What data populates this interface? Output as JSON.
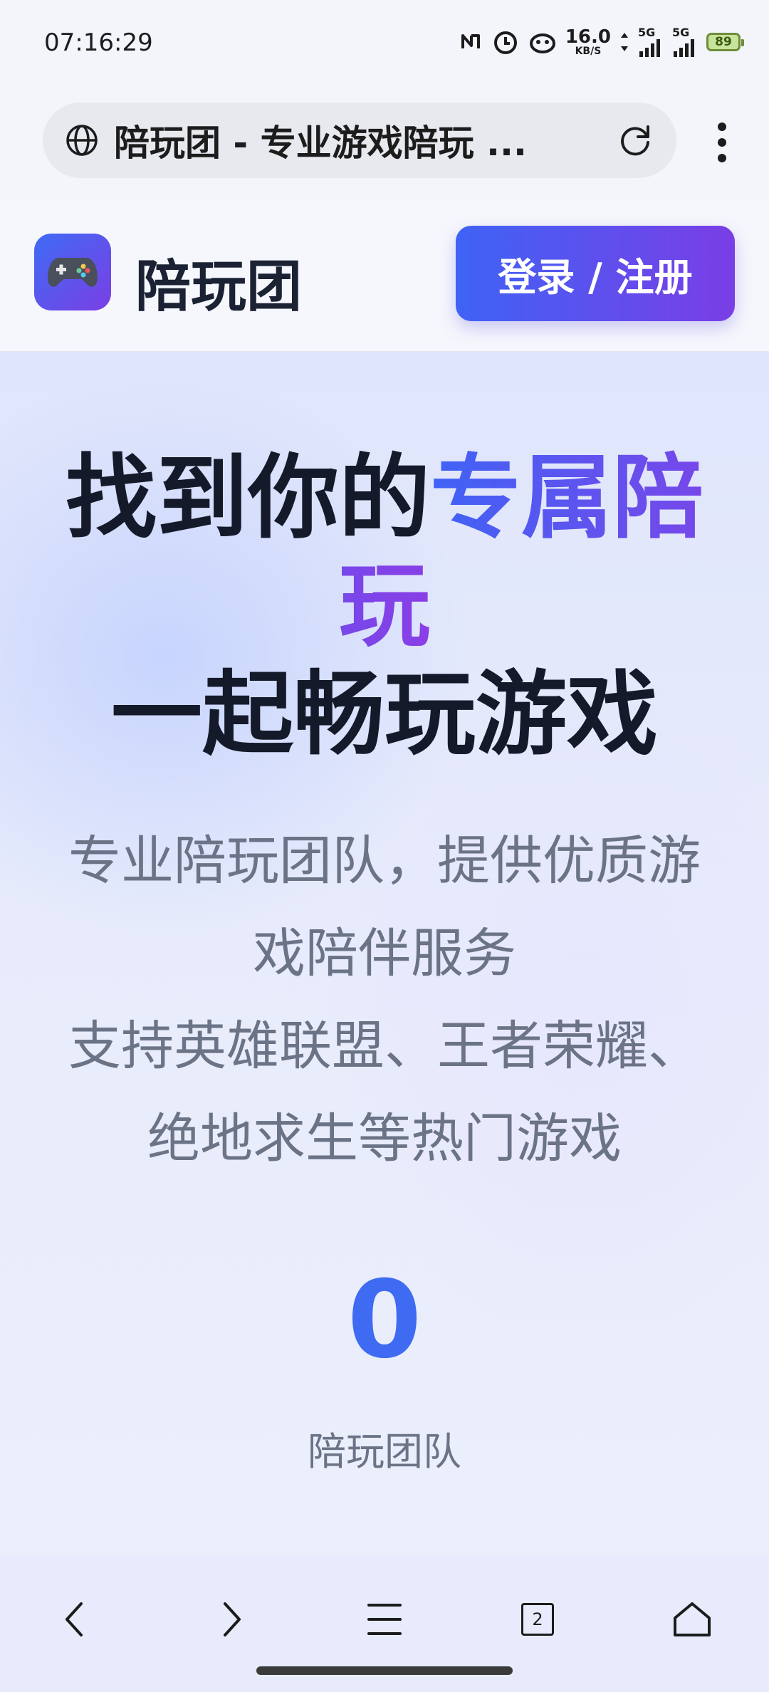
{
  "status_bar": {
    "time": "07:16:29",
    "net_speed_value": "16.0",
    "net_speed_unit": "KB/S",
    "signal_label_1": "5G",
    "signal_label_2": "5G",
    "battery": "89",
    "icons": [
      "nfc-icon",
      "alarm-icon",
      "app-notification-icon",
      "data-transfer-icon",
      "signal-icon",
      "signal-icon",
      "battery-icon"
    ]
  },
  "browser": {
    "page_title": "陪玩团 - 专业游戏陪玩 ...",
    "icons": [
      "globe-icon",
      "reload-icon",
      "more-options-icon"
    ]
  },
  "site_header": {
    "name": "陪玩团",
    "logo_icon": "gamepad-icon",
    "login_label": "登录 / 注册"
  },
  "hero": {
    "title_part1": "找到你的",
    "title_accent": "专属陪玩",
    "title_part2": "一起畅玩游戏",
    "desc_line1": "专业陪玩团队，提供优质游戏陪伴服务",
    "desc_line2": "支持英雄联盟、王者荣耀、绝地求生等热门游戏",
    "stat_value": "0",
    "stat_label": "陪玩团队",
    "accent_colors": [
      "#3f63f5",
      "#8a3ee6"
    ]
  },
  "bottom_nav": {
    "tab_count": "2",
    "icons": [
      "back-icon",
      "forward-icon",
      "menu-icon",
      "tabs-icon",
      "home-icon"
    ]
  }
}
